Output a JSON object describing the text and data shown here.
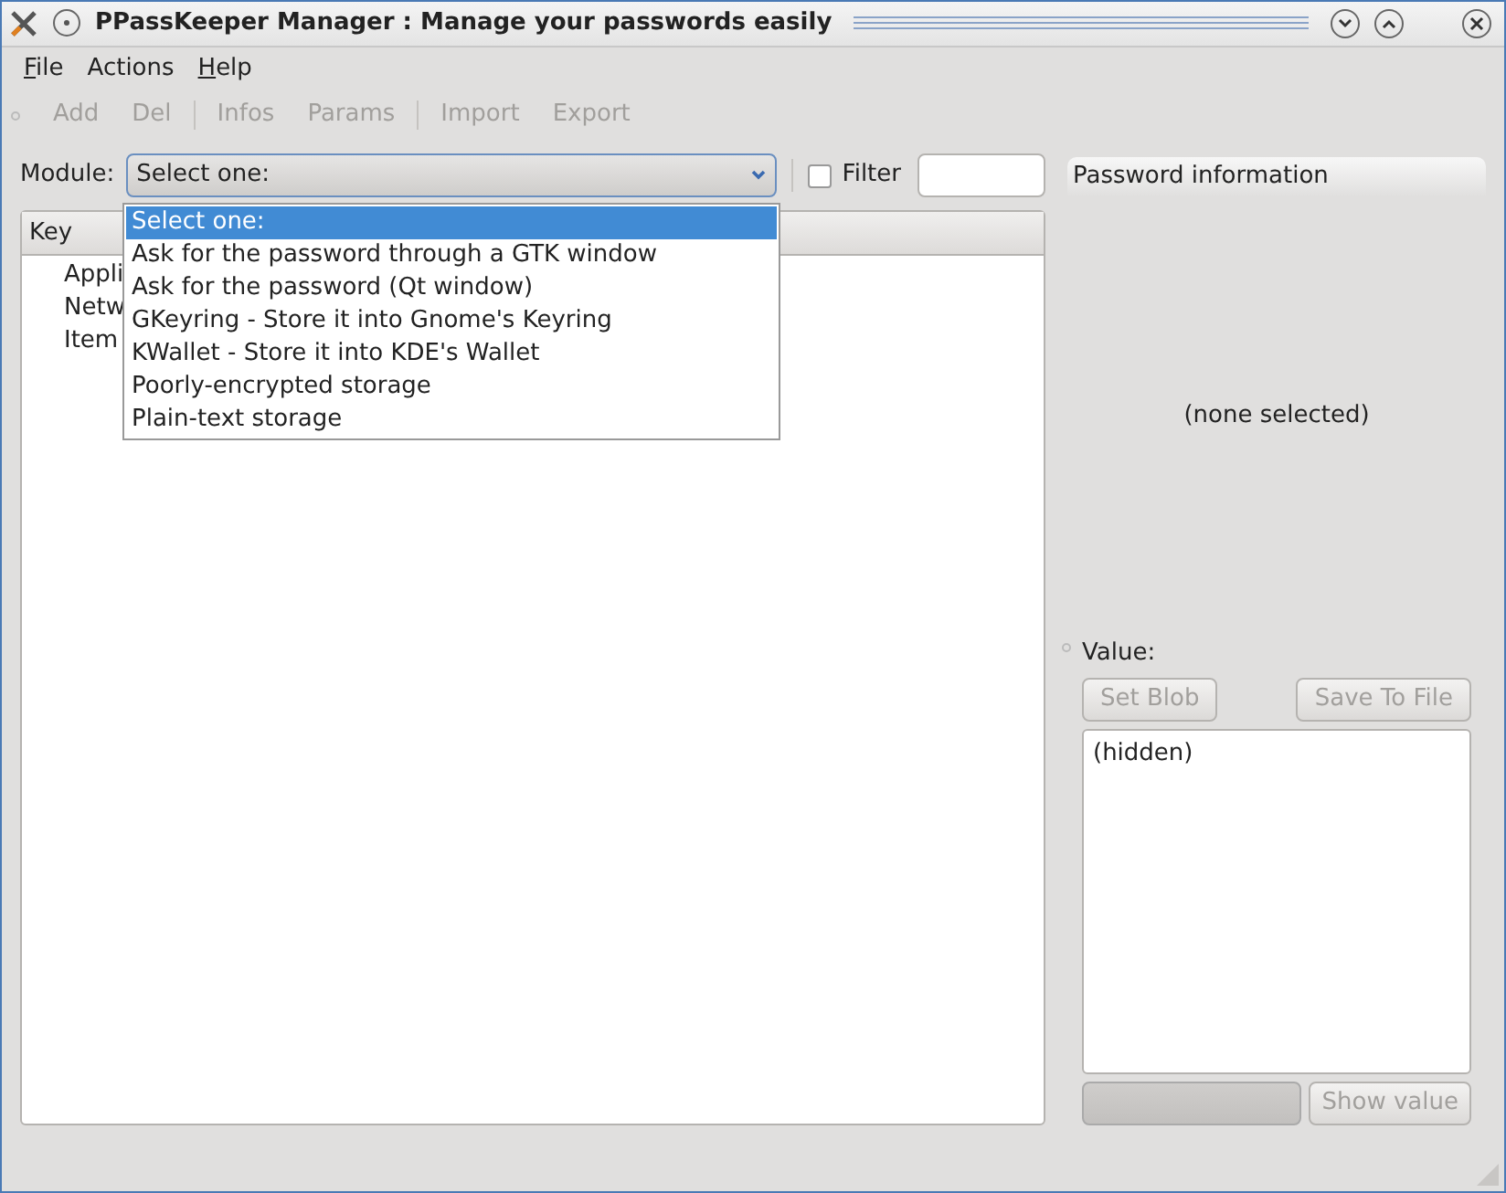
{
  "window": {
    "title": "PPassKeeper Manager : Manage your passwords easily"
  },
  "menu": [
    {
      "label": "File",
      "underlined": true
    },
    {
      "label": "Actions",
      "underlined": false
    },
    {
      "label": "Help",
      "underlined": true
    }
  ],
  "toolbar": [
    {
      "kind": "button",
      "label": "Add",
      "disabled": true
    },
    {
      "kind": "button",
      "label": "Del",
      "disabled": true
    },
    {
      "kind": "separator"
    },
    {
      "kind": "button",
      "label": "Infos",
      "disabled": true
    },
    {
      "kind": "button",
      "label": "Params",
      "disabled": true
    },
    {
      "kind": "separator"
    },
    {
      "kind": "button",
      "label": "Import",
      "disabled": true
    },
    {
      "kind": "button",
      "label": "Export",
      "disabled": true
    }
  ],
  "module": {
    "label": "Module:",
    "value": "Select one:",
    "expanded": true,
    "options": [
      {
        "label": "Select one:",
        "selected": true
      },
      {
        "label": "Ask for the password through a GTK window",
        "selected": false
      },
      {
        "label": "Ask for the password (Qt window)",
        "selected": false
      },
      {
        "label": "GKeyring - Store it into Gnome's Keyring",
        "selected": false
      },
      {
        "label": "KWallet - Store it into KDE's Wallet",
        "selected": false
      },
      {
        "label": "Poorly-encrypted storage",
        "selected": false
      },
      {
        "label": "Plain-text storage",
        "selected": false
      }
    ]
  },
  "filter": {
    "label": "Filter",
    "checked": false
  },
  "tree": {
    "columns": [
      "Key"
    ],
    "items": [
      "Appli",
      "Netw",
      "Item"
    ]
  },
  "info": {
    "title": "Password information",
    "status": "(none selected)",
    "value_label": "Value:",
    "buttons": [
      {
        "label": "Set Blob",
        "disabled": true
      },
      {
        "label": "Save To File",
        "disabled": true
      }
    ],
    "value": "(hidden)",
    "show_button": {
      "label": "Show value",
      "disabled": true
    }
  }
}
